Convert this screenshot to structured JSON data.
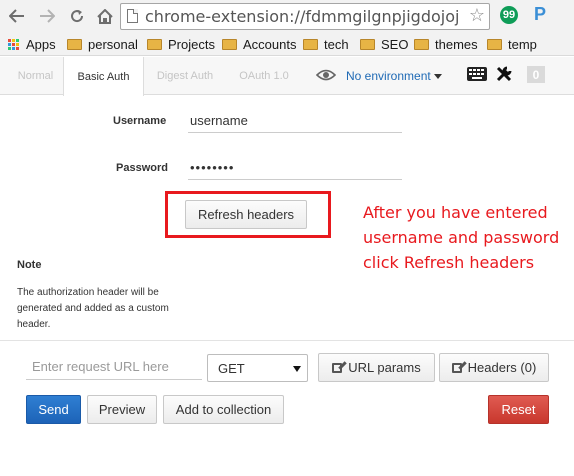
{
  "browser": {
    "url": "chrome-extension://fdmmgilgnpjigdojojpjoc",
    "hangouts_badge": "99",
    "ext_p_label": "P"
  },
  "bookmarks": [
    {
      "label": "Apps",
      "icon": "apps-grid-icon"
    },
    {
      "label": "personal",
      "icon": "folder-icon"
    },
    {
      "label": "Projects",
      "icon": "folder-icon"
    },
    {
      "label": "Accounts",
      "icon": "folder-icon"
    },
    {
      "label": "tech",
      "icon": "folder-icon"
    },
    {
      "label": "SEO",
      "icon": "folder-icon"
    },
    {
      "label": "themes",
      "icon": "folder-icon"
    },
    {
      "label": "temp",
      "icon": "folder-icon"
    }
  ],
  "tabs": [
    {
      "label": "Normal",
      "active": false
    },
    {
      "label": "Basic Auth",
      "active": true
    },
    {
      "label": "Digest Auth",
      "active": false
    },
    {
      "label": "OAuth 1.0",
      "active": false
    }
  ],
  "environment": {
    "label": "No environment"
  },
  "toolbar": {
    "badge_count": "0"
  },
  "auth": {
    "username_label": "Username",
    "username_value": "username",
    "password_label": "Password",
    "password_value": "••••••••",
    "refresh_label": "Refresh headers"
  },
  "annotation": {
    "line1": "After you have entered",
    "line2": "username and password",
    "line3": "click Refresh headers"
  },
  "note": {
    "title": "Note",
    "text": "The authorization header will be generated and added as a custom header."
  },
  "request": {
    "url_placeholder": "Enter request URL here",
    "method": "GET",
    "url_params_label": "URL params",
    "headers_label": "Headers (0)",
    "send_label": "Send",
    "preview_label": "Preview",
    "add_collection_label": "Add to collection",
    "reset_label": "Reset"
  },
  "colors": {
    "annotation_red": "#e8191e",
    "send_blue": "#1d63b8",
    "reset_red": "#c8372d",
    "link_blue": "#1f6ab5"
  }
}
